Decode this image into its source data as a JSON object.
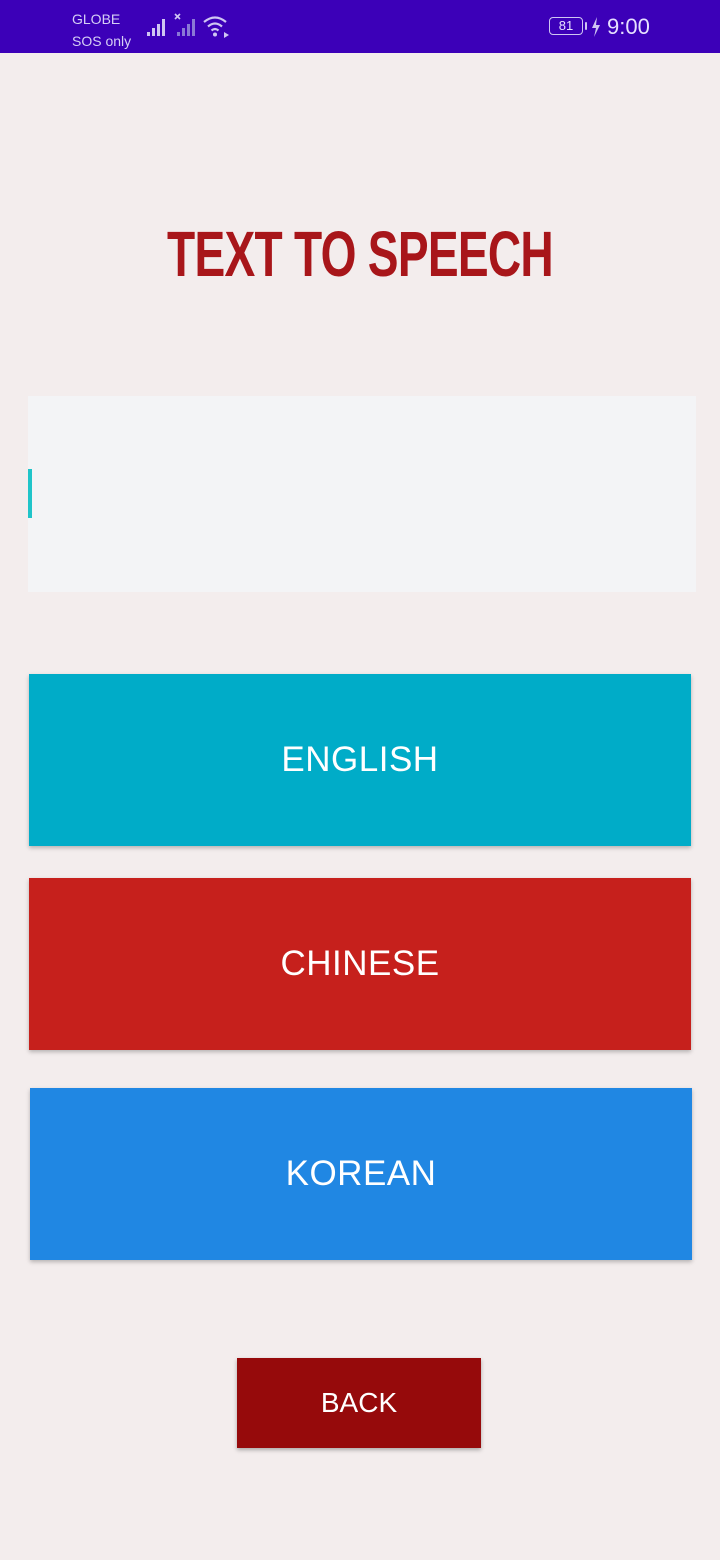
{
  "status_bar": {
    "carrier_name": "GLOBE",
    "carrier_status": "SOS only",
    "battery_level": "81",
    "time": "9:00",
    "icons": [
      "signal-icon",
      "signal-no-service-icon",
      "wifi-icon",
      "battery-icon",
      "charging-bolt-icon"
    ],
    "background_color": "#3c00b8"
  },
  "main": {
    "title": "TEXT TO SPEECH",
    "title_color": "#a8161a",
    "text_input": {
      "value": "",
      "placeholder": ""
    },
    "buttons": [
      {
        "label": "ENGLISH",
        "color": "#00acc8"
      },
      {
        "label": "CHINESE",
        "color": "#c6201c"
      },
      {
        "label": "KOREAN",
        "color": "#2087e3"
      }
    ],
    "back_button": {
      "label": "BACK",
      "color": "#960a0b"
    }
  }
}
